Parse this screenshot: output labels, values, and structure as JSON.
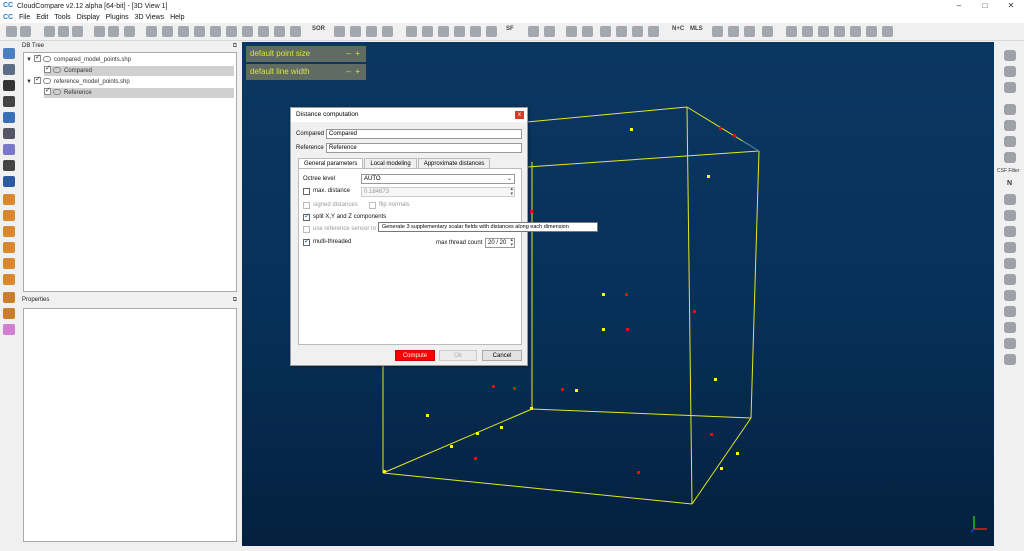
{
  "window": {
    "title": "CloudCompare v2.12 alpha [64-bit] - [3D View 1]",
    "logo": "CC",
    "minimize": "–",
    "maximize": "□",
    "close": "✕"
  },
  "menu": {
    "logo": "CC",
    "items": [
      "File",
      "Edit",
      "Tools",
      "Display",
      "Plugins",
      "3D Views",
      "Help"
    ]
  },
  "toolbar": {
    "texts": [
      "SOR",
      "SF",
      "N+C",
      "MLS"
    ]
  },
  "rightbar": {
    "csp_label": "CSF Filter",
    "n_label": "N"
  },
  "db_tree": {
    "title": "DB Tree",
    "nodes": [
      {
        "label": "compared_model_points.shp",
        "level": 0,
        "selected": false
      },
      {
        "label": "Compared",
        "level": 1,
        "selected": true
      },
      {
        "label": "reference_model_points.shp",
        "level": 0,
        "selected": false
      },
      {
        "label": "Reference",
        "level": 1,
        "selected": true
      }
    ]
  },
  "properties": {
    "title": "Properties"
  },
  "overlay": {
    "point_size": "default point size",
    "line_width": "default line width",
    "minus": "–",
    "plus": "+"
  },
  "dialog": {
    "title": "Distance computation",
    "close": "x",
    "compared_label": "Compared",
    "compared_value": "Compared",
    "reference_label": "Reference",
    "reference_value": "Reference",
    "tabs": [
      "General parameters",
      "Local modeling",
      "Approximate distances"
    ],
    "octree_label": "Octree level",
    "octree_value": "AUTO",
    "max_distance_label": "max. distance",
    "max_distance_value": "0.184673",
    "signed_distances_label": "signed distances",
    "flip_normals_label": "flip normals",
    "split_label": "split X,Y and Z components",
    "use_sensor_label": "use reference sensor to fi",
    "multithreaded_label": "multi-threaded",
    "max_thread_label": "max thread count",
    "max_thread_value": "20 / 20",
    "compute_button": "Compute",
    "ok_button": "Ok",
    "cancel_button": "Cancel"
  },
  "tooltip": {
    "text": "Generate 3 supplementary scalar fields with distances along each dimension"
  },
  "colors": {
    "viewport_bg": "#0a3762",
    "box_lines": "#e6e622",
    "point_yellow": "#ffff00",
    "point_red": "#e01010",
    "compute_red": "#ff0000"
  }
}
